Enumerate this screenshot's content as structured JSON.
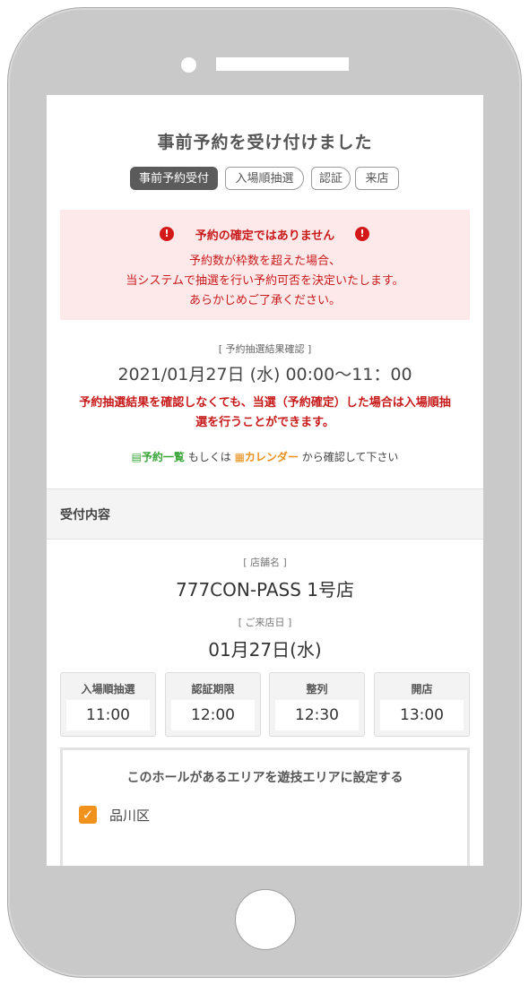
{
  "page": {
    "title": "事前予約を受け付けました",
    "steps": [
      "事前予約受付",
      "入場順抽選",
      "認証",
      "来店"
    ],
    "alert": {
      "title": "予約の確定ではありません",
      "lines": [
        "予約数が枠数を超えた場合、",
        "当システムで抽選を行い予約可否を決定いたします。",
        "あらかじめご了承ください。"
      ]
    },
    "lottery": {
      "label": "[ 予約抽選結果確認 ]",
      "time": "2021/01月27日 (水) 00:00〜11：00",
      "note_lines": [
        "予約抽選結果を確認しなくても、当選（予約確定）した場合は入場順抽",
        "選を行うことができます。"
      ]
    },
    "links": {
      "list": "予約一覧",
      "or": " もしくは ",
      "calendar": "カレンダー",
      "suffix": " から確認して下さい"
    },
    "section_title": "受付内容",
    "store": {
      "label": "[ 店舗名 ]",
      "value": "777CON-PASS 1号店"
    },
    "visit": {
      "label": "[ ご来店日 ]",
      "value": "01月27日(水)"
    },
    "tiles": [
      {
        "title": "入場順抽選",
        "value": "11:00"
      },
      {
        "title": "認証期限",
        "value": "12:00"
      },
      {
        "title": "整列",
        "value": "12:30"
      },
      {
        "title": "開店",
        "value": "13:00"
      }
    ],
    "area": {
      "title": "このホールがあるエリアを遊技エリアに設定する",
      "checkbox_label": "品川区",
      "checked": true
    }
  },
  "colors": {
    "alert_bg": "#fde8ea",
    "alert_text": "#c81a1a",
    "active_step": "#5b5b5b",
    "link_green": "#3aa53a",
    "link_orange": "#e8901b",
    "checkbox": "#f0921c",
    "phone_frame": "#c9c9c9"
  },
  "icons": {
    "alert": "exclamation-circle-icon",
    "list": "document-icon",
    "calendar": "calendar-icon",
    "check": "checkmark-icon"
  }
}
